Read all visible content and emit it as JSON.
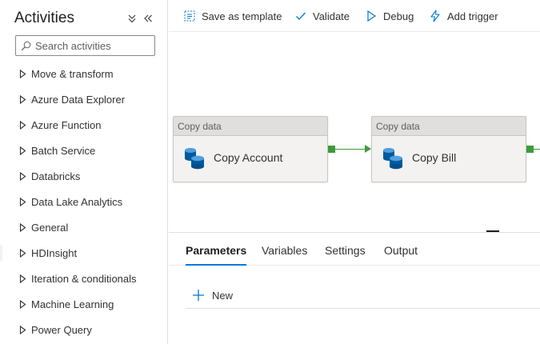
{
  "colors": {
    "accent": "#0078d4",
    "connector_green": "#3c9b3a",
    "box_header": "#e1dfdd",
    "box_body": "#f3f2f1"
  },
  "sidebar": {
    "title": "Activities",
    "collapse_all_icon": "chevron-double-down-icon",
    "collapse_panel_icon": "chevron-double-left-icon",
    "search": {
      "placeholder": "Search activities",
      "value": "",
      "icon": "search-icon"
    },
    "items": [
      {
        "label": "Move & transform",
        "icon": "caret-right-icon"
      },
      {
        "label": "Azure Data Explorer",
        "icon": "caret-right-icon"
      },
      {
        "label": "Azure Function",
        "icon": "caret-right-icon"
      },
      {
        "label": "Batch Service",
        "icon": "caret-right-icon"
      },
      {
        "label": "Databricks",
        "icon": "caret-right-icon"
      },
      {
        "label": "Data Lake Analytics",
        "icon": "caret-right-icon"
      },
      {
        "label": "General",
        "icon": "caret-right-icon"
      },
      {
        "label": "HDInsight",
        "icon": "caret-right-icon"
      },
      {
        "label": "Iteration & conditionals",
        "icon": "caret-right-icon"
      },
      {
        "label": "Machine Learning",
        "icon": "caret-right-icon"
      },
      {
        "label": "Power Query",
        "icon": "caret-right-icon"
      }
    ]
  },
  "toolbar": {
    "save_as_template": {
      "label": "Save as template",
      "icon": "template-icon"
    },
    "validate": {
      "label": "Validate",
      "icon": "checkmark-icon"
    },
    "debug": {
      "label": "Debug",
      "icon": "play-icon"
    },
    "add_trigger": {
      "label": "Add trigger",
      "icon": "lightning-icon"
    }
  },
  "canvas": {
    "activities": [
      {
        "type_label": "Copy data",
        "name": "Copy Account",
        "icon": "database-icon"
      },
      {
        "type_label": "Copy data",
        "name": "Copy Bill",
        "icon": "database-icon"
      }
    ]
  },
  "bottom_panel": {
    "tabs": [
      {
        "label": "Parameters",
        "active": true
      },
      {
        "label": "Variables",
        "active": false
      },
      {
        "label": "Settings",
        "active": false
      },
      {
        "label": "Output",
        "active": false
      }
    ],
    "new_button": {
      "label": "New",
      "icon": "plus-icon"
    }
  }
}
